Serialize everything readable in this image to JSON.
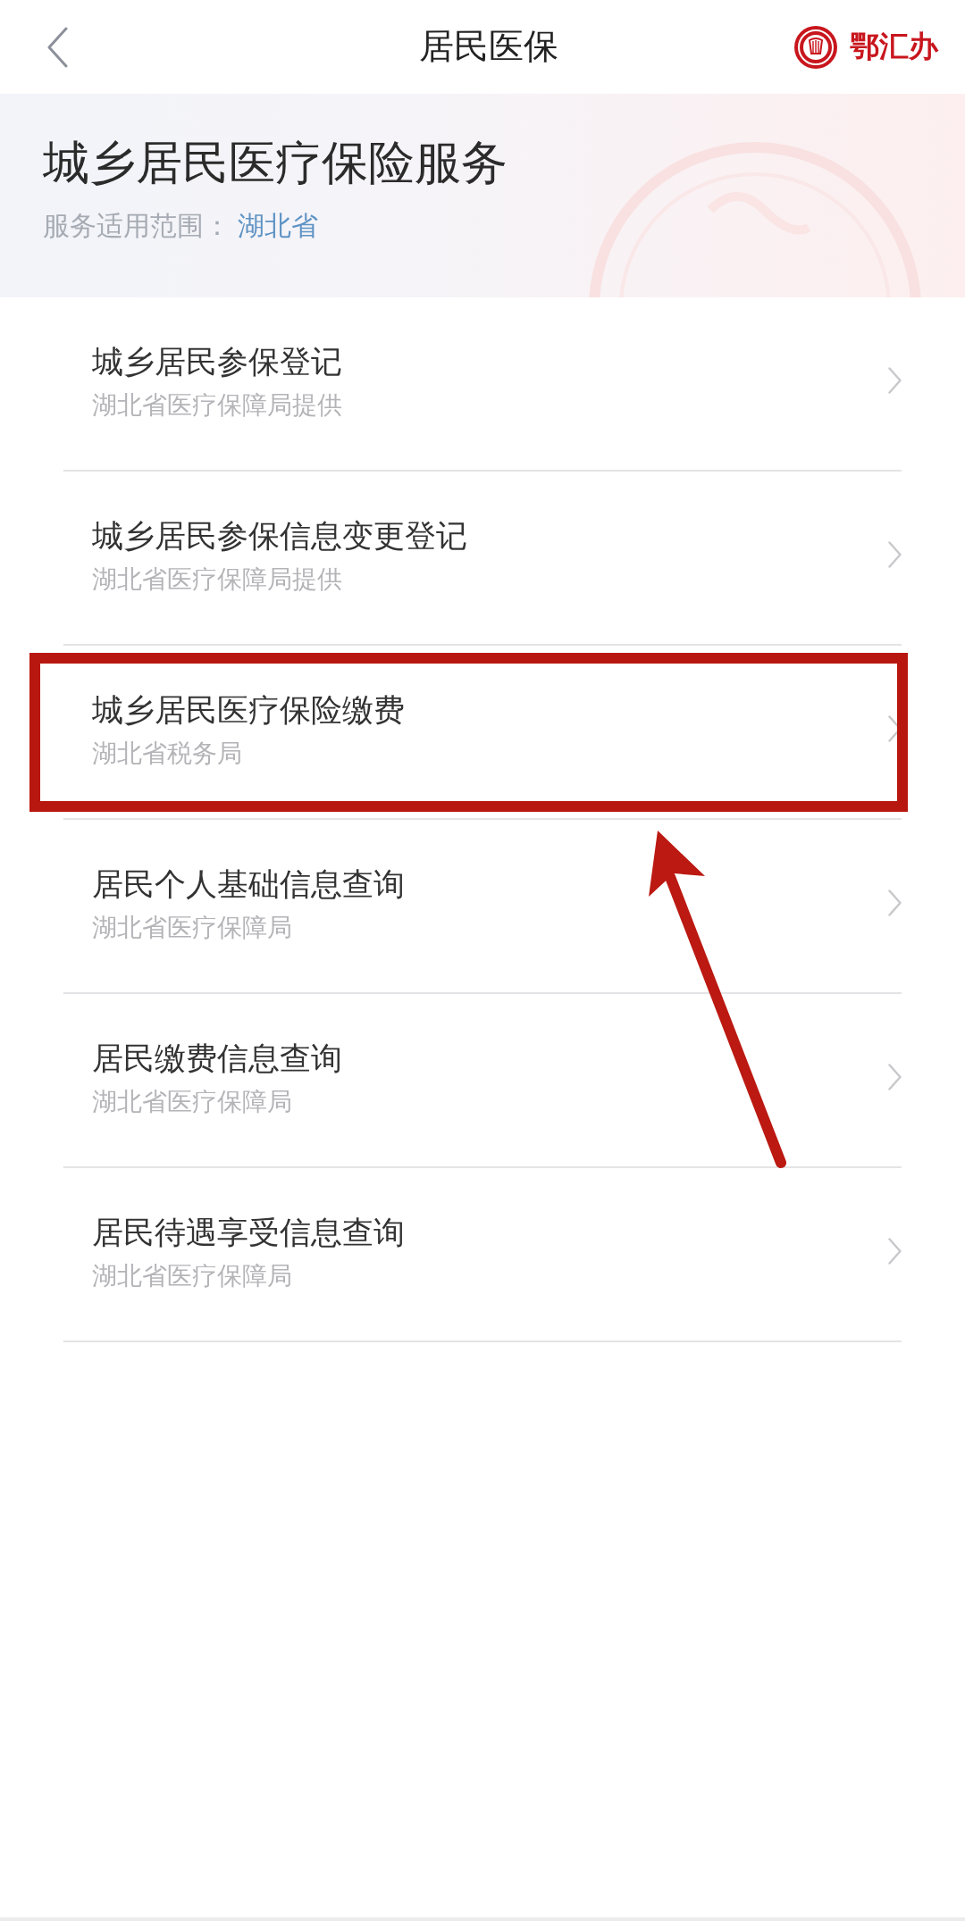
{
  "nav": {
    "title": "居民医保",
    "logo_text": "鄂汇办"
  },
  "banner": {
    "title": "城乡居民医疗保险服务",
    "scope_label": "服务适用范围：",
    "scope_value": "湖北省"
  },
  "services": [
    {
      "name": "城乡居民参保登记",
      "provider": "湖北省医疗保障局提供",
      "highlighted": false
    },
    {
      "name": "城乡居民参保信息变更登记",
      "provider": "湖北省医疗保障局提供",
      "highlighted": false
    },
    {
      "name": "城乡居民医疗保险缴费",
      "provider": "湖北省税务局",
      "highlighted": true
    },
    {
      "name": "居民个人基础信息查询",
      "provider": "湖北省医疗保障局",
      "highlighted": false
    },
    {
      "name": "居民缴费信息查询",
      "provider": "湖北省医疗保障局",
      "highlighted": false
    },
    {
      "name": "居民待遇享受信息查询",
      "provider": "湖北省医疗保障局",
      "highlighted": false
    }
  ]
}
